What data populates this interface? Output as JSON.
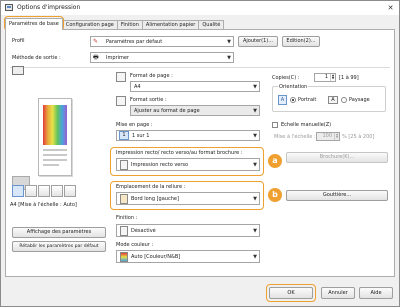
{
  "window": {
    "title": "Options d'impression",
    "close_label": "✕"
  },
  "tabs": [
    {
      "label": "Paramètres de base"
    },
    {
      "label": "Configuration page"
    },
    {
      "label": "Finition"
    },
    {
      "label": "Alimentation papier"
    },
    {
      "label": "Qualité"
    }
  ],
  "profile": {
    "label": "Profil",
    "value": "Paramètres par défaut",
    "add_button": "Ajouter(1)...",
    "edit_button": "Edition(2)..."
  },
  "output_method": {
    "label": "Méthode de sortie :",
    "value": "Imprimer"
  },
  "preview": {
    "caption": "A4 [Mise à l'échelle : Auto]"
  },
  "page_size": {
    "label": "Format de page :",
    "value": "A4"
  },
  "output_size": {
    "label": "Format sortie :",
    "value": "Ajuster au format de page"
  },
  "copies": {
    "label": "Copies(C) :",
    "value": "1",
    "range": "[1 à 99]"
  },
  "orientation": {
    "label": "Orientation",
    "portrait": "Portrait",
    "landscape": "Paysage"
  },
  "layout": {
    "label": "Mise en page :",
    "value": "1 sur 1",
    "icon_text": "1"
  },
  "manual_scaling": {
    "label": "Echelle manuelle(Z)",
    "scaling_label": "Mise à l'échelle :",
    "value": "100",
    "range": "% [25 à 200]"
  },
  "duplex": {
    "label": "Impression recto/ recto verso/au format brochure :",
    "value": "Impression recto verso",
    "badge": "a"
  },
  "booklet_button": "Brochure(K)...",
  "binding": {
    "label": "Emplacement de la reliure :",
    "value": "Bord long [gauche]",
    "badge": "b"
  },
  "gutter_button": "Gouttière...",
  "finishing": {
    "label": "Finition :",
    "value": "Désactivé"
  },
  "color_mode": {
    "label": "Mode couleur :",
    "value": "Auto [Couleur/N&B]"
  },
  "left_buttons": {
    "show_settings": "Affichage des paramètres",
    "restore_defaults": "Rétablir les paramètres par défaut"
  },
  "footer": {
    "ok": "OK",
    "cancel": "Annuler",
    "help": "Aide"
  },
  "colors": {
    "highlight": "#f0a030",
    "accent": "#5a87c6"
  }
}
